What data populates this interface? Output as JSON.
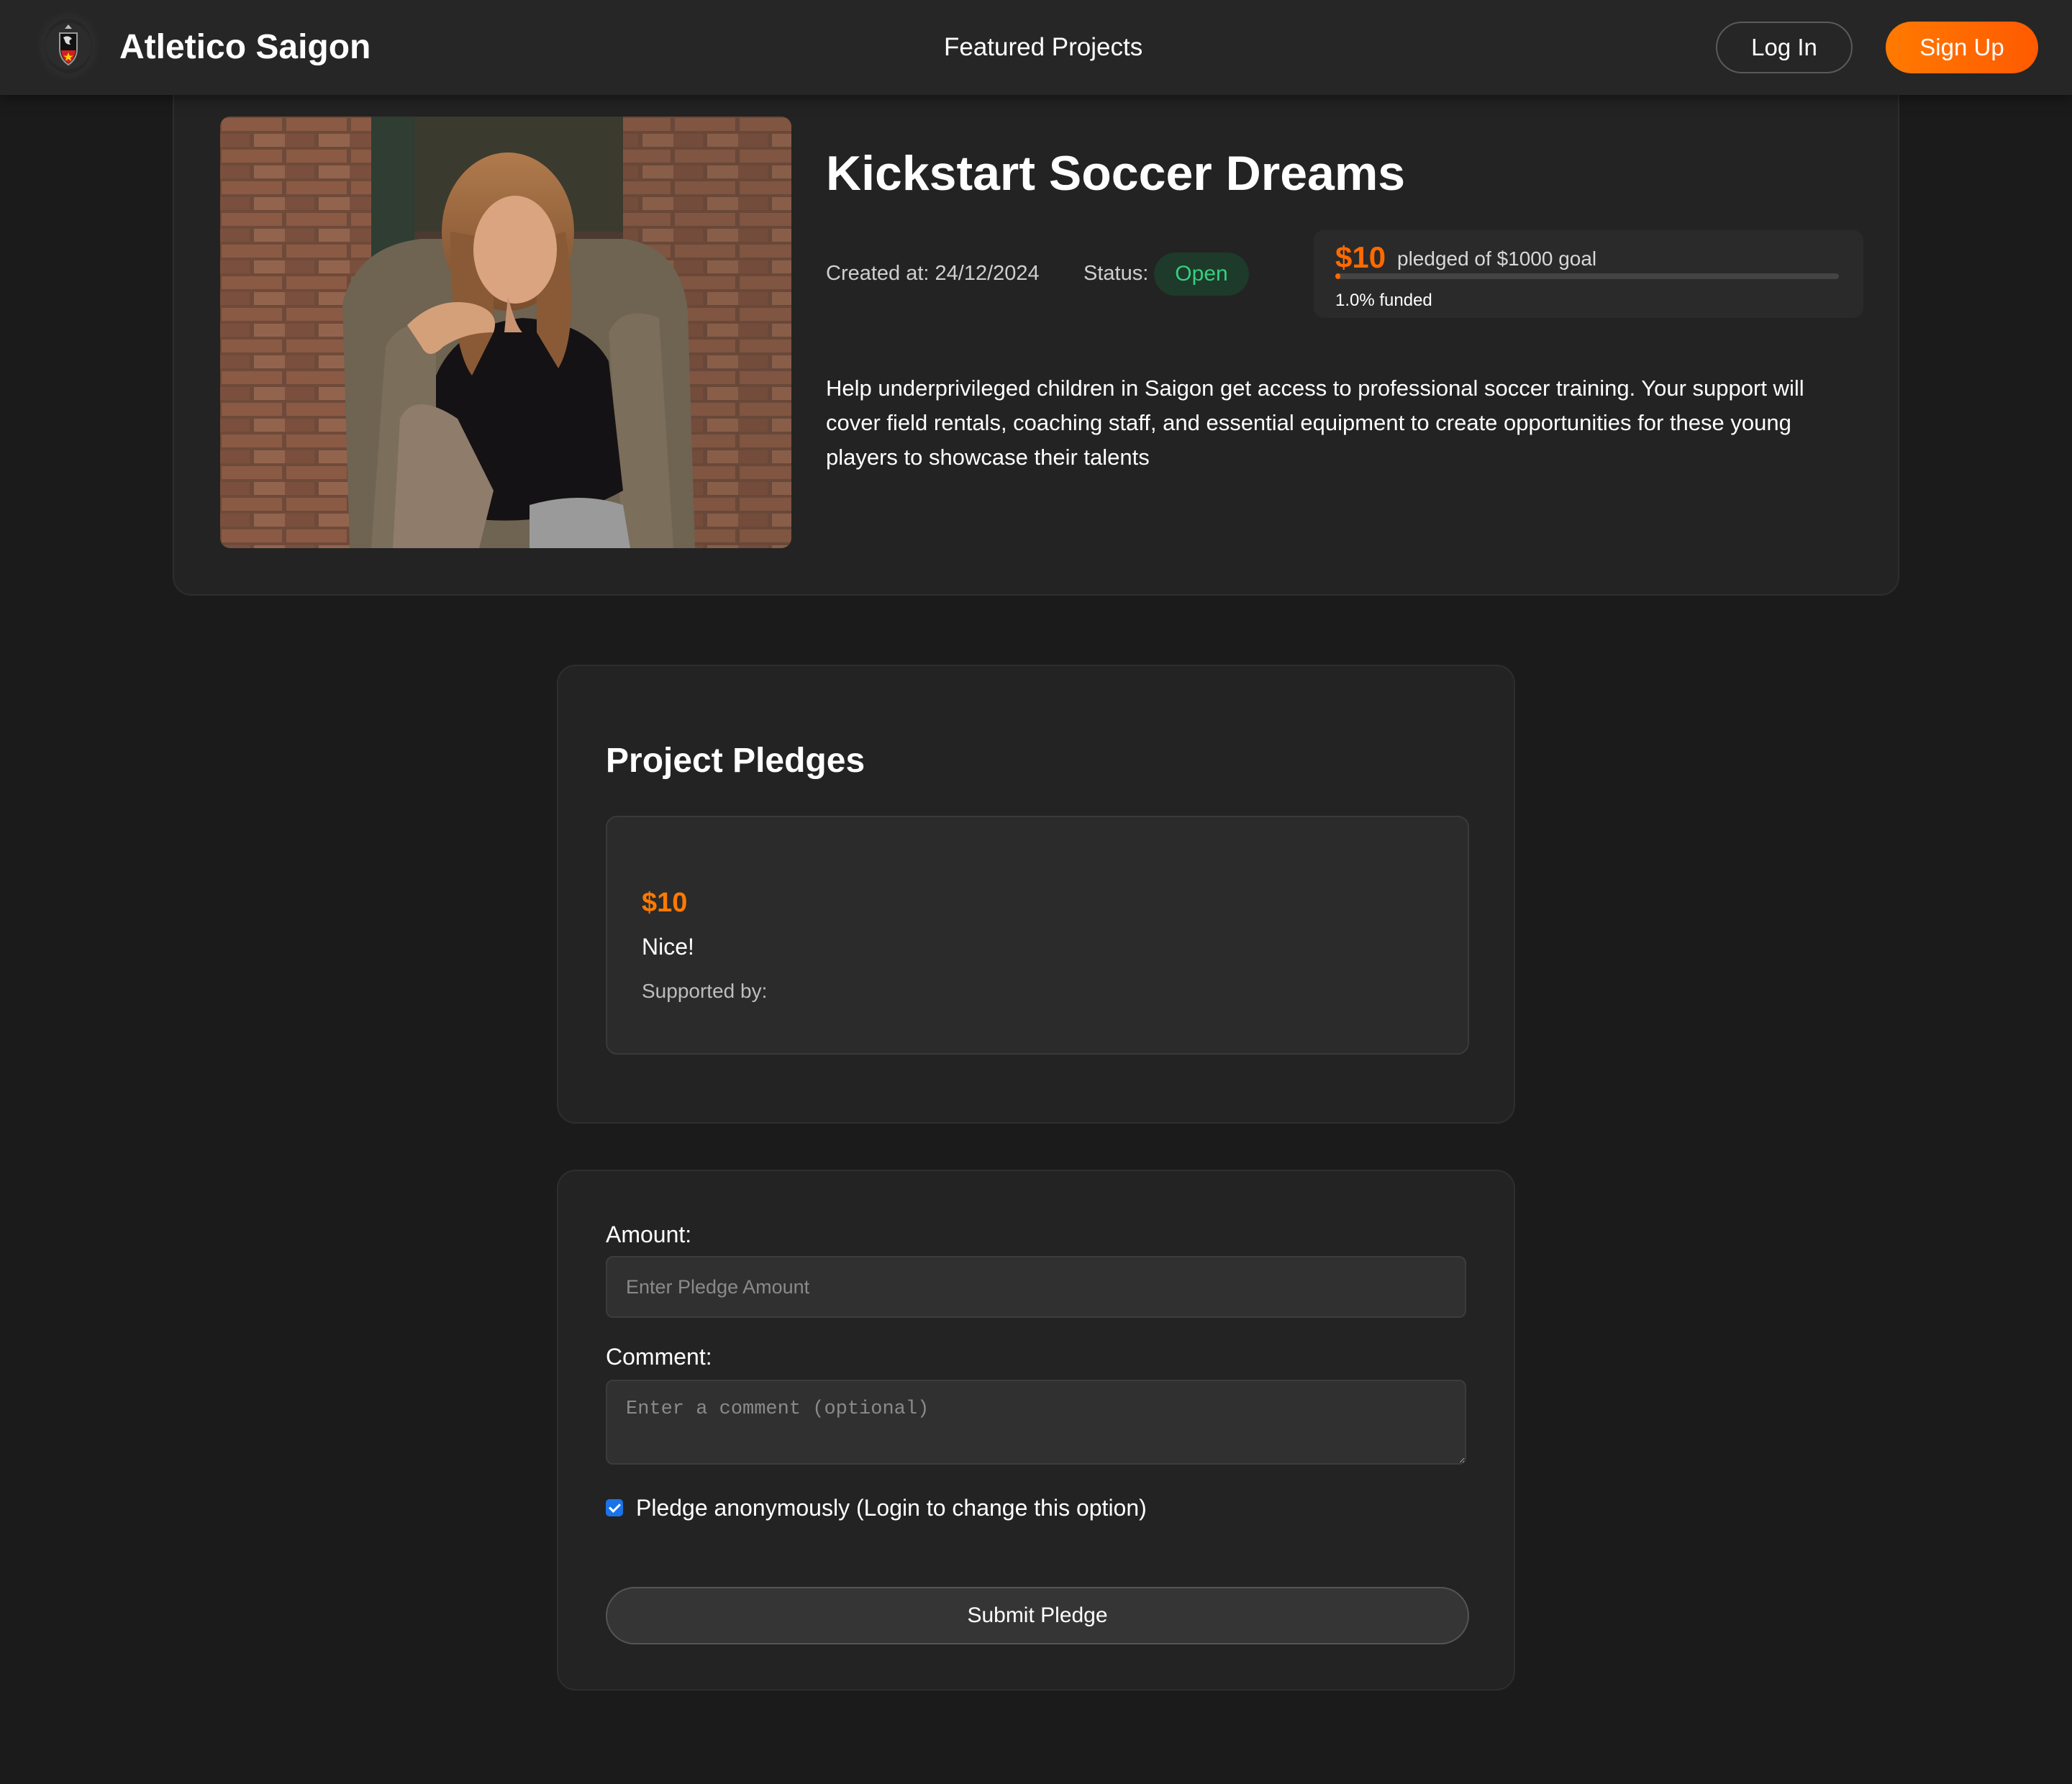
{
  "navbar": {
    "brand": "Atletico Saigon",
    "nav_link": "Featured Projects",
    "login_label": "Log In",
    "signup_label": "Sign Up",
    "accent_color": "#ff6a00"
  },
  "project": {
    "title": "Kickstart Soccer Dreams",
    "created": "Created at: 24/12/2024",
    "status_label": "Status:",
    "status_value": "Open",
    "pledged_amount": "$10",
    "pledged_goal_text": "pledged of $1000 goal",
    "funded_percent": 1.0,
    "funded_text": "1.0% funded",
    "description": "Help underprivileged children in Saigon get access to professional soccer training. Your support will cover field rentals, coaching staff, and essential equipment to create opportunities for these young players to showcase their talents",
    "image_icon": "project-photo"
  },
  "pledges": {
    "title": "Project Pledges",
    "items": [
      {
        "amount": "$10",
        "comment": "Nice!",
        "supporter_label": "Supported by:"
      }
    ]
  },
  "form": {
    "amount_label": "Amount:",
    "amount_placeholder": "Enter Pledge Amount",
    "comment_label": "Comment:",
    "comment_placeholder": "Enter a comment (optional)",
    "anonymous_checked": true,
    "anonymous_label": "Pledge anonymously (Login to change this option)",
    "submit_label": "Submit Pledge"
  }
}
